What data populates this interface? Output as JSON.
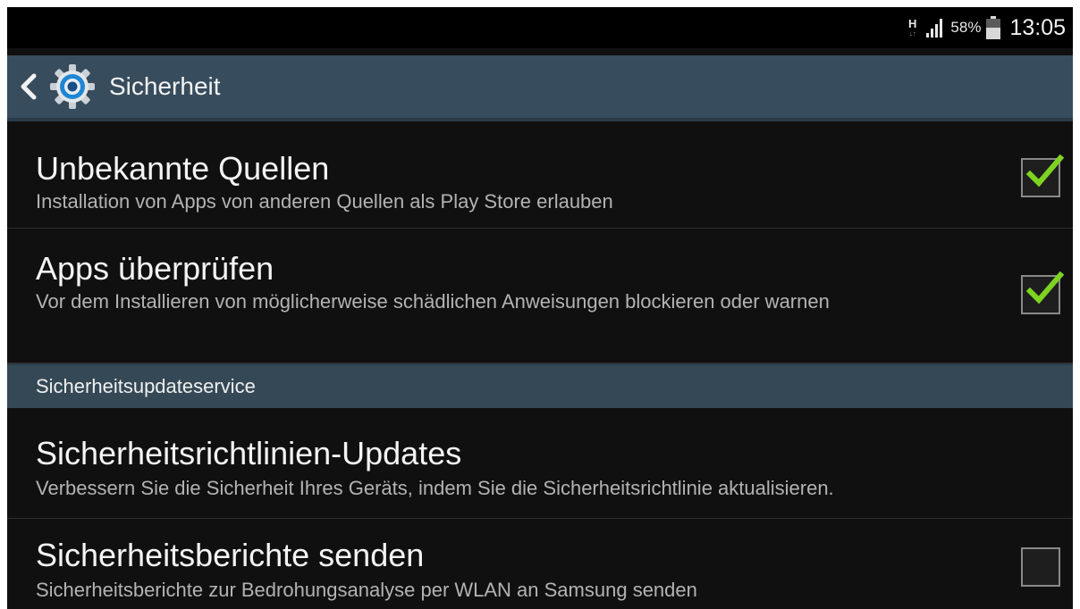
{
  "status_bar": {
    "network_type": "H",
    "network_arrows": "↓↑",
    "battery_percent": "58%",
    "time": "13:05",
    "icons": [
      "signal-icon",
      "battery-icon"
    ]
  },
  "action_bar": {
    "title": "Sicherheit",
    "back_icon": "chevron-left-icon",
    "app_icon": "gear-icon",
    "color": "#374c5c"
  },
  "settings": [
    {
      "title": "Unbekannte Quellen",
      "subtitle": "Installation von Apps von anderen Quellen als Play Store erlauben",
      "checked": true
    },
    {
      "title": "Apps überprüfen",
      "subtitle": "Vor dem Installieren von möglicherweise schädlichen Anweisungen blockieren oder warnen",
      "checked": true
    }
  ],
  "section": {
    "title": "Sicherheitsupdateservice"
  },
  "settings_update": [
    {
      "title": "Sicherheitsrichtlinien-Updates",
      "subtitle": "Verbessern Sie die Sicherheit Ihres Geräts, indem Sie die Sicherheitsrichtlinie aktualisieren."
    },
    {
      "title": "Sicherheitsberichte senden",
      "subtitle": "Sicherheitsberichte zur Bedrohungsanalyse per WLAN an Samsung senden",
      "checked": false
    }
  ],
  "colors": {
    "check_green": "#7ed321",
    "background": "#101010",
    "section_header": "#354856"
  }
}
